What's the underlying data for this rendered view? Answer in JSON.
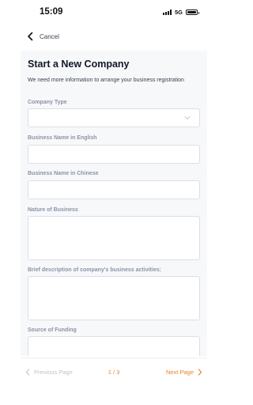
{
  "status_bar": {
    "time": "15:09",
    "network": "5G"
  },
  "nav": {
    "cancel_label": "Cancel"
  },
  "form": {
    "title": "Start a New Company",
    "subtitle": "We need more information to arrange your business registration",
    "fields": {
      "company_type": {
        "label": "Company Type",
        "value": ""
      },
      "business_name_en": {
        "label": "Business Name in English",
        "value": ""
      },
      "business_name_zh": {
        "label": "Business Name in Chinese",
        "value": ""
      },
      "nature_of_business": {
        "label": "Nature of Business",
        "value": ""
      },
      "brief_description": {
        "label": "Brief description of company's business activities:",
        "value": ""
      },
      "source_of_funding": {
        "label": "Source of Funding",
        "value": ""
      }
    }
  },
  "pagination": {
    "prev_label": "Previous Page",
    "page_indicator": "1 / 3",
    "next_label": "Next Page"
  },
  "colors": {
    "accent": "#e8832a",
    "disabled": "#c0c4cc",
    "label": "#8b93a7",
    "card_background": "#f7f8fa"
  },
  "icons": {
    "back": "chevron-left-icon",
    "dropdown": "chevron-down-icon",
    "prev": "chevron-left-icon",
    "next": "chevron-right-icon"
  }
}
